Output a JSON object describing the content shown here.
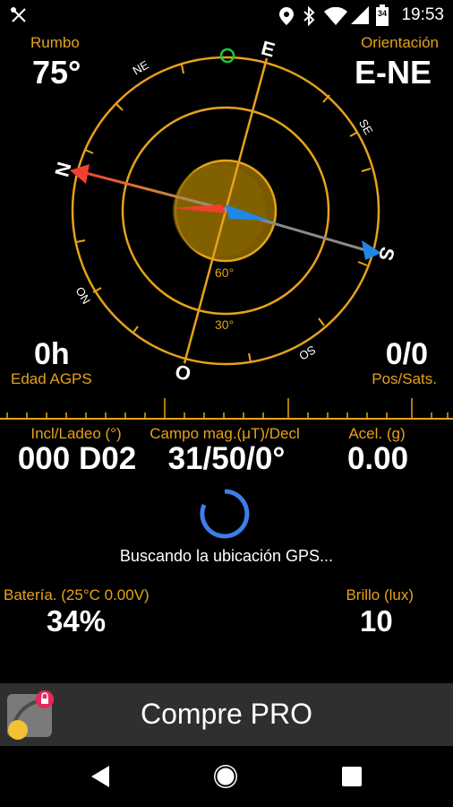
{
  "status_bar": {
    "time": "19:53",
    "icons": [
      "satellite-icon",
      "location-icon",
      "bluetooth-icon",
      "wifi-icon",
      "signal-icon",
      "battery-icon"
    ],
    "battery_label": "34"
  },
  "compass": {
    "rumbo_label": "Rumbo",
    "rumbo_value": "75°",
    "orientacion_label": "Orientación",
    "orientacion_value": "E-NE",
    "cardinals": {
      "N": "N",
      "E": "E",
      "S": "S",
      "O": "O",
      "NE": "NE",
      "SE": "SE",
      "SO": "SO",
      "NO": "NO"
    },
    "ring_60": "60°",
    "ring_30": "30°"
  },
  "agps": {
    "value": "0h",
    "label": "Edad AGPS"
  },
  "possats": {
    "value": "0/0",
    "label": "Pos/Sats."
  },
  "metrics": [
    {
      "label": "Incl/Ladeo (°)",
      "value": "000 D02"
    },
    {
      "label": "Campo mag.(μT)/Decl",
      "value": "31/50/0°"
    },
    {
      "label": "Acel. (g)",
      "value": "0.00"
    }
  ],
  "search_status": "Buscando la ubicación GPS...",
  "battery": {
    "label": "Batería. (25°C 0.00V)",
    "value": "34%"
  },
  "brightness": {
    "label": "Brillo (lux)",
    "value": "10"
  },
  "promo": {
    "text": "Compre PRO",
    "icon": "app-icon"
  },
  "nav": {
    "back": "back-icon",
    "home": "home-icon",
    "recents": "recents-icon"
  },
  "colors": {
    "accent": "#e6a21a",
    "needle_red": "#f04030",
    "needle_blue": "#1e88e5",
    "spinner": "#3f7ee8"
  }
}
